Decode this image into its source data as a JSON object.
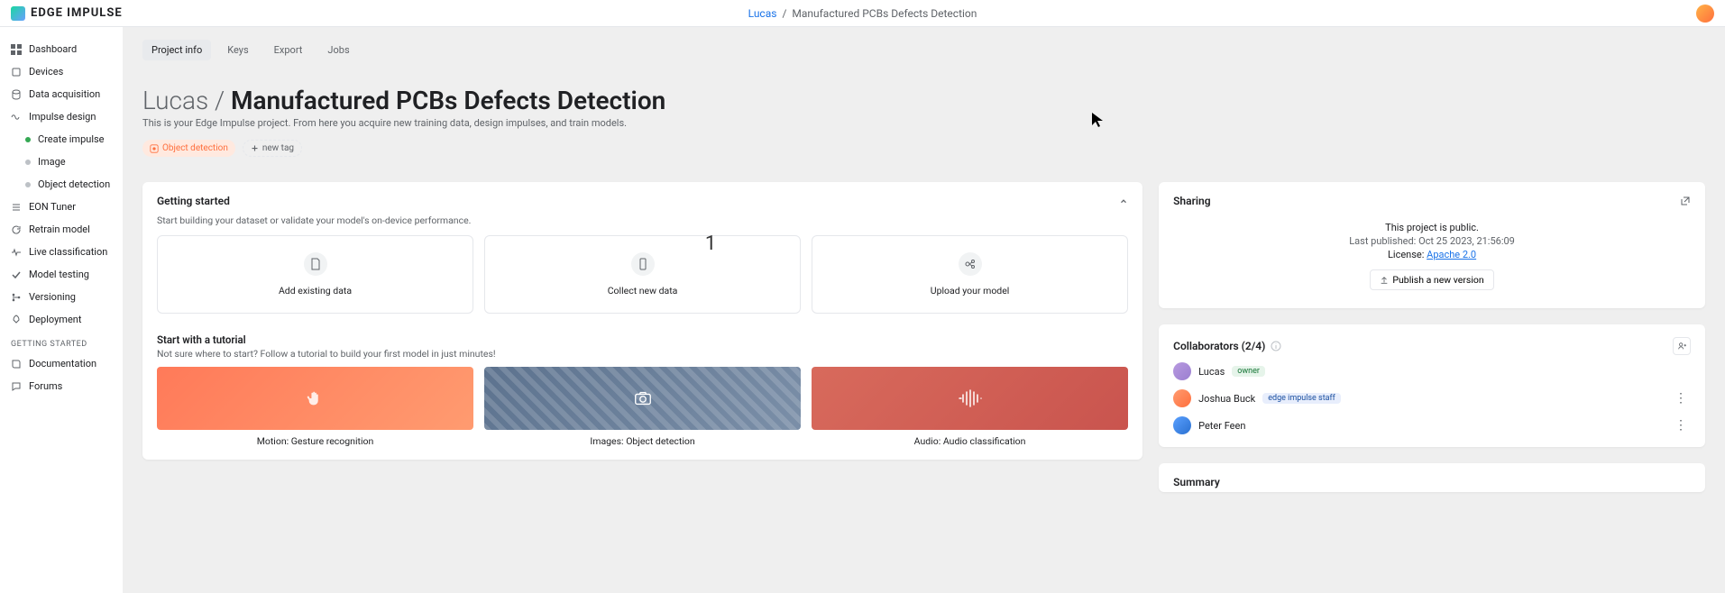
{
  "brand": "EDGE IMPULSE",
  "breadcrumb": {
    "user": "Lucas",
    "sep": "/",
    "project": "Manufactured PCBs Defects Detection"
  },
  "sidebar": {
    "items": [
      {
        "label": "Dashboard"
      },
      {
        "label": "Devices"
      },
      {
        "label": "Data acquisition"
      },
      {
        "label": "Impulse design"
      }
    ],
    "impulse_children": [
      {
        "label": "Create impulse",
        "dot": "green"
      },
      {
        "label": "Image",
        "dot": "gray"
      },
      {
        "label": "Object detection",
        "dot": "gray"
      }
    ],
    "items_tail": [
      {
        "label": "EON Tuner"
      },
      {
        "label": "Retrain model"
      },
      {
        "label": "Live classification"
      },
      {
        "label": "Model testing"
      },
      {
        "label": "Versioning"
      },
      {
        "label": "Deployment"
      }
    ],
    "section_label": "GETTING STARTED",
    "bottom": [
      {
        "label": "Documentation"
      },
      {
        "label": "Forums"
      }
    ]
  },
  "tabs": [
    {
      "label": "Project info",
      "active": true
    },
    {
      "label": "Keys"
    },
    {
      "label": "Export"
    },
    {
      "label": "Jobs"
    }
  ],
  "title": {
    "prefix": "Lucas / ",
    "name": "Manufactured PCBs Defects Detection"
  },
  "sub_line": "This is your Edge Impulse project. From here you acquire new training data, design impulses, and train models.",
  "tags": {
    "category": "Object detection",
    "new_tag": "new tag"
  },
  "getting_started": {
    "heading": "Getting started",
    "subtext": "Start building your dataset or validate your model's on-device performance.",
    "tiles": [
      {
        "label": "Add existing data"
      },
      {
        "label": "Collect new data"
      },
      {
        "label": "Upload your model"
      }
    ]
  },
  "start_tutorial": {
    "heading": "Start with a tutorial",
    "subtext": "Not sure where to start? Follow a tutorial to build your first model in just minutes!",
    "tiles": [
      {
        "label": "Motion: Gesture recognition",
        "kind": "motion"
      },
      {
        "label": "Images: Object detection",
        "kind": "images"
      },
      {
        "label": "Audio: Audio classification",
        "kind": "audio"
      }
    ]
  },
  "sharing": {
    "heading": "Sharing",
    "public_line": "This project is public.",
    "published_line": "Last published: Oct 25 2023, 21:56:09",
    "license_label": "License: ",
    "license_value": "Apache 2.0",
    "publish_btn": "Publish a new version"
  },
  "collaborators": {
    "heading": "Collaborators (2/4)",
    "rows": [
      {
        "name": "Lucas",
        "role": "owner",
        "role_class": "owner"
      },
      {
        "name": "Joshua Buck",
        "role": "edge impulse staff",
        "role_class": "edge"
      },
      {
        "name": "Peter Feen",
        "role": "",
        "role_class": ""
      }
    ]
  },
  "summary": {
    "heading": "Summary"
  },
  "overlay": {
    "countdown": "1"
  }
}
